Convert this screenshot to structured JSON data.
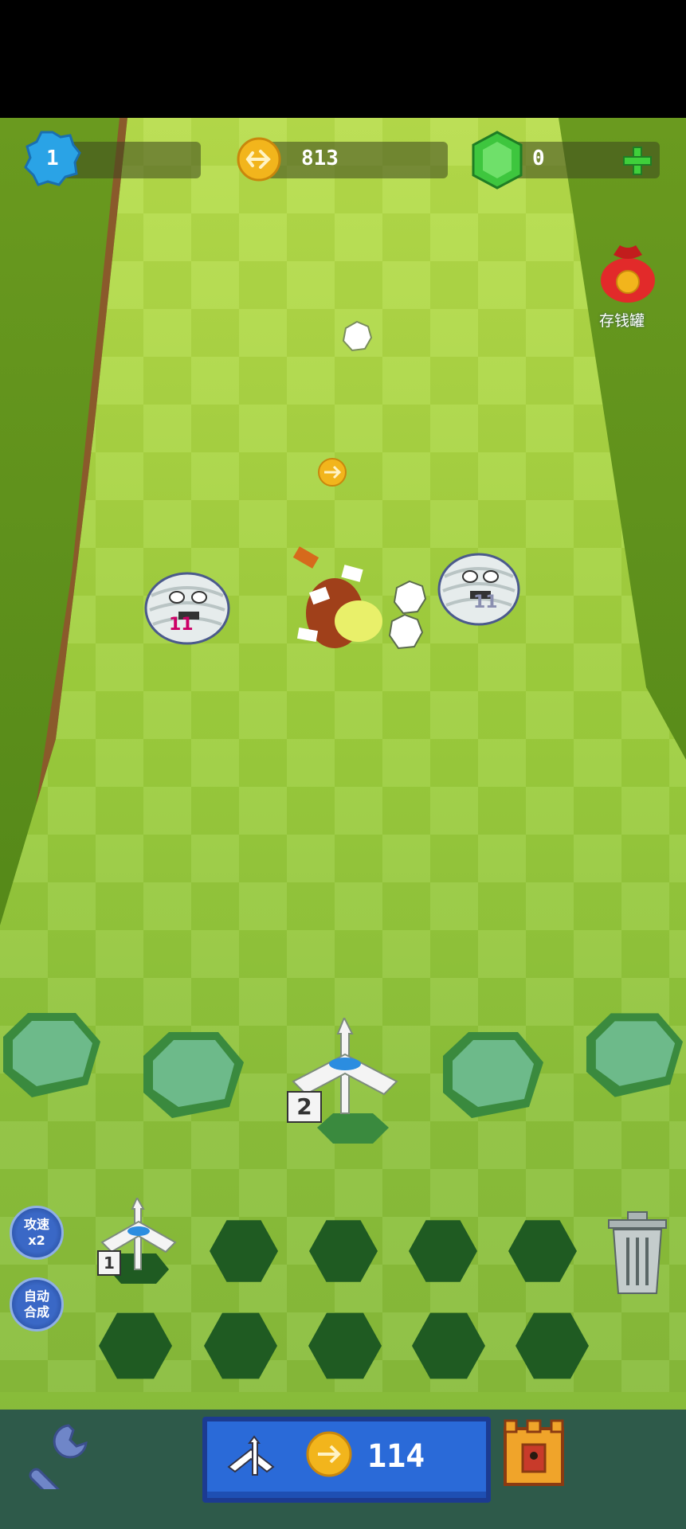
{
  "hud": {
    "level": "1",
    "coins": "813",
    "gems": "0"
  },
  "piggy_bank": {
    "label": "存钱罐"
  },
  "enemies": [
    {
      "hp": "11"
    },
    {
      "hp": "11"
    }
  ],
  "active_turret": {
    "level": "2"
  },
  "inventory": {
    "turret_level": "1"
  },
  "side_buttons": {
    "speed": "攻速\nx2",
    "speed_line1": "攻速",
    "speed_line2": "x2",
    "auto_line1": "自动",
    "auto_line2": "合成"
  },
  "buy_button": {
    "price": "114"
  },
  "colors": {
    "accent": "#2a6ad8",
    "coin": "#f2b51c",
    "gem": "#3ec63e",
    "enemy_hp": "#cc0066"
  }
}
